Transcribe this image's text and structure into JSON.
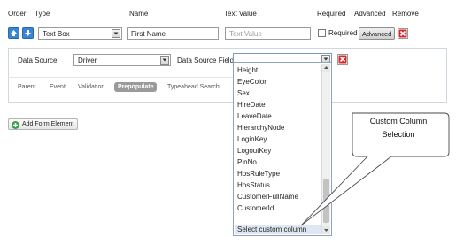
{
  "headers": {
    "order": "Order",
    "type": "Type",
    "name": "Name",
    "text_value": "Text Value",
    "required": "Required",
    "advanced": "Advanced",
    "remove": "Remove"
  },
  "row": {
    "type_value": "Text Box",
    "name_value": "First Name",
    "text_value_placeholder": "Text Value",
    "required_label": "Required",
    "advanced_button": "Advanced"
  },
  "panel": {
    "data_source_label": "Data Source:",
    "data_source_value": "Driver",
    "data_source_field_label": "Data Source Field:",
    "data_source_field_value": "",
    "tabs": [
      {
        "label": "Parent",
        "active": false
      },
      {
        "label": "Event",
        "active": false
      },
      {
        "label": "Validation",
        "active": false
      },
      {
        "label": "Prepopulate",
        "active": true
      },
      {
        "label": "Typeahead Search",
        "active": false
      }
    ]
  },
  "add_form_element": "Add Form Element",
  "dropdown": {
    "items": [
      "Height",
      "EyeColor",
      "Sex",
      "HireDate",
      "LeaveDate",
      "HierarchyNode",
      "LoginKey",
      "LogoutKey",
      "PinNo",
      "HosRuleType",
      "HosStatus",
      "CustomerFullName",
      "CustomerId"
    ],
    "selected": "Select custom column"
  },
  "callout": {
    "line1": "Custom Column",
    "line2": "Selection"
  },
  "colors": {
    "arrow_blue": "#3a86d6",
    "delete_red": "#d42a2a",
    "add_green": "#37a046",
    "active_tab_bg": "#9a9a9a",
    "selected_item_bg": "#dfe7f2"
  },
  "icons": [
    "arrow-up-icon",
    "arrow-down-icon",
    "chevron-down-icon",
    "delete-x-icon",
    "plus-circle-icon"
  ]
}
